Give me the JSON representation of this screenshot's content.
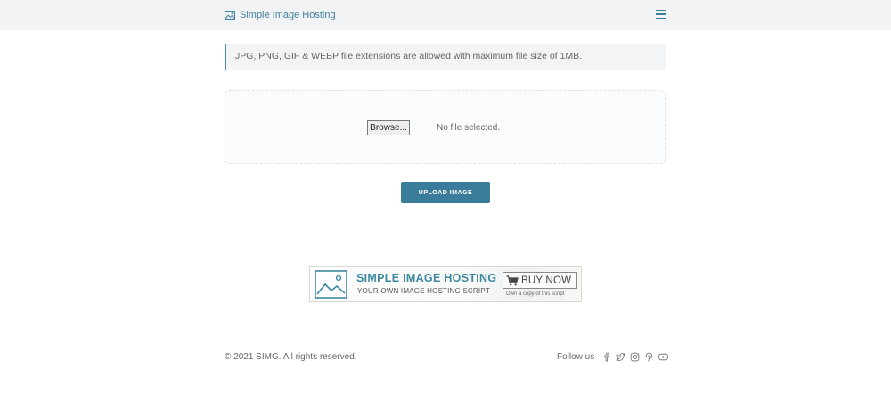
{
  "header": {
    "brand": "Simple Image Hosting",
    "brand_icon": "image-icon",
    "menu_icon": "hamburger-menu-icon",
    "accent_color": "#3f7f9d"
  },
  "notice": {
    "text": "JPG, PNG, GIF & WEBP file extensions are allowed with maximum file size of 1MB."
  },
  "upload": {
    "browse_label": "Browse...",
    "file_status": "No file selected.",
    "submit_label": "UPLOAD IMAGE",
    "button_color": "#3b7c9a"
  },
  "banner": {
    "title": "SIMPLE IMAGE HOSTING",
    "subtitle": "YOUR OWN IMAGE HOSTING SCRIPT",
    "buy_label": "BUY NOW",
    "buy_caption": "Own a copy of this script",
    "icons": [
      "image-icon",
      "shopping-cart-icon"
    ]
  },
  "footer": {
    "copyright": "© 2021 SIMG. All rights reserved.",
    "follow_label": "Follow us",
    "social_icons": [
      "facebook-icon",
      "twitter-icon",
      "instagram-icon",
      "pinterest-icon",
      "youtube-icon"
    ]
  }
}
